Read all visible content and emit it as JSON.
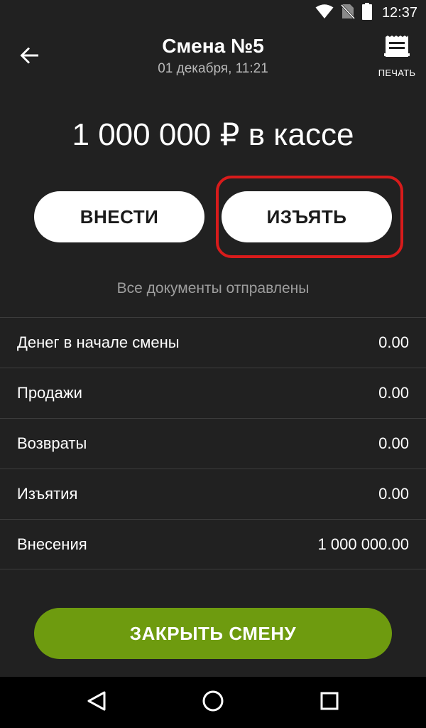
{
  "status_bar": {
    "time": "12:37",
    "icons": [
      "wifi-icon",
      "no-sim-icon",
      "battery-icon"
    ]
  },
  "app_bar": {
    "title": "Смена №5",
    "subtitle": "01 декабря, 11:21",
    "print_label": "ПЕЧАТЬ",
    "back_icon": "arrow-back-icon",
    "print_icon": "receipt-printer-icon"
  },
  "cash_amount": "1 000 000 ₽ в кассе",
  "actions": {
    "deposit_label": "ВНЕСТИ",
    "withdraw_label": "ИЗЪЯТЬ"
  },
  "docs_status": "Все документы отправлены",
  "summary": [
    {
      "label": "Денег в начале смены",
      "value": "0.00"
    },
    {
      "label": "Продажи",
      "value": "0.00"
    },
    {
      "label": "Возвраты",
      "value": "0.00"
    },
    {
      "label": "Изъятия",
      "value": "0.00"
    },
    {
      "label": "Внесения",
      "value": "1 000 000.00"
    }
  ],
  "close_shift_label": "ЗАКРЫТЬ СМЕНУ",
  "nav_bar": {
    "icons": [
      "nav-back-icon",
      "nav-home-icon",
      "nav-recents-icon"
    ]
  },
  "colors": {
    "background": "#212121",
    "accent_green": "#6e9b0f",
    "highlight_red": "#d81b1b",
    "button_white": "#ffffff"
  }
}
